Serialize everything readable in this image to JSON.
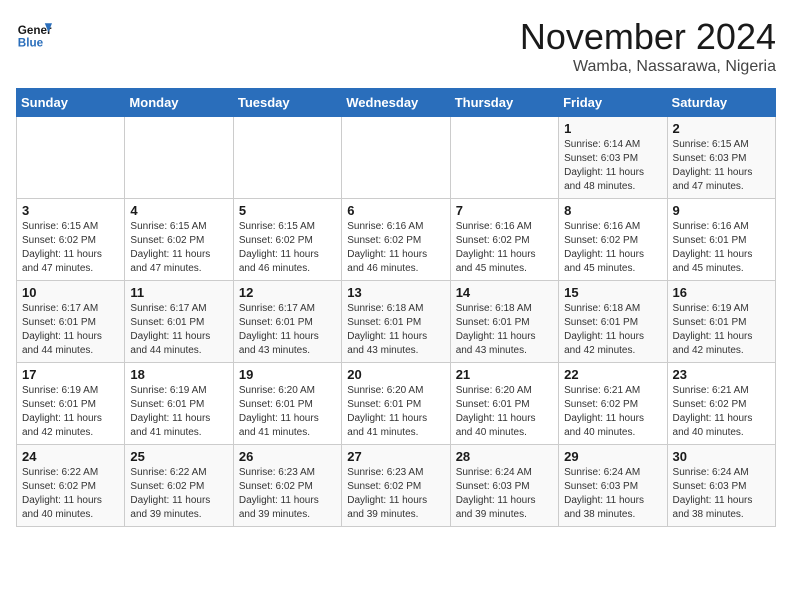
{
  "header": {
    "logo_line1": "General",
    "logo_line2": "Blue",
    "month": "November 2024",
    "location": "Wamba, Nassarawa, Nigeria"
  },
  "days_of_week": [
    "Sunday",
    "Monday",
    "Tuesday",
    "Wednesday",
    "Thursday",
    "Friday",
    "Saturday"
  ],
  "weeks": [
    [
      {
        "day": "",
        "info": ""
      },
      {
        "day": "",
        "info": ""
      },
      {
        "day": "",
        "info": ""
      },
      {
        "day": "",
        "info": ""
      },
      {
        "day": "",
        "info": ""
      },
      {
        "day": "1",
        "info": "Sunrise: 6:14 AM\nSunset: 6:03 PM\nDaylight: 11 hours and 48 minutes."
      },
      {
        "day": "2",
        "info": "Sunrise: 6:15 AM\nSunset: 6:03 PM\nDaylight: 11 hours and 47 minutes."
      }
    ],
    [
      {
        "day": "3",
        "info": "Sunrise: 6:15 AM\nSunset: 6:02 PM\nDaylight: 11 hours and 47 minutes."
      },
      {
        "day": "4",
        "info": "Sunrise: 6:15 AM\nSunset: 6:02 PM\nDaylight: 11 hours and 47 minutes."
      },
      {
        "day": "5",
        "info": "Sunrise: 6:15 AM\nSunset: 6:02 PM\nDaylight: 11 hours and 46 minutes."
      },
      {
        "day": "6",
        "info": "Sunrise: 6:16 AM\nSunset: 6:02 PM\nDaylight: 11 hours and 46 minutes."
      },
      {
        "day": "7",
        "info": "Sunrise: 6:16 AM\nSunset: 6:02 PM\nDaylight: 11 hours and 45 minutes."
      },
      {
        "day": "8",
        "info": "Sunrise: 6:16 AM\nSunset: 6:02 PM\nDaylight: 11 hours and 45 minutes."
      },
      {
        "day": "9",
        "info": "Sunrise: 6:16 AM\nSunset: 6:01 PM\nDaylight: 11 hours and 45 minutes."
      }
    ],
    [
      {
        "day": "10",
        "info": "Sunrise: 6:17 AM\nSunset: 6:01 PM\nDaylight: 11 hours and 44 minutes."
      },
      {
        "day": "11",
        "info": "Sunrise: 6:17 AM\nSunset: 6:01 PM\nDaylight: 11 hours and 44 minutes."
      },
      {
        "day": "12",
        "info": "Sunrise: 6:17 AM\nSunset: 6:01 PM\nDaylight: 11 hours and 43 minutes."
      },
      {
        "day": "13",
        "info": "Sunrise: 6:18 AM\nSunset: 6:01 PM\nDaylight: 11 hours and 43 minutes."
      },
      {
        "day": "14",
        "info": "Sunrise: 6:18 AM\nSunset: 6:01 PM\nDaylight: 11 hours and 43 minutes."
      },
      {
        "day": "15",
        "info": "Sunrise: 6:18 AM\nSunset: 6:01 PM\nDaylight: 11 hours and 42 minutes."
      },
      {
        "day": "16",
        "info": "Sunrise: 6:19 AM\nSunset: 6:01 PM\nDaylight: 11 hours and 42 minutes."
      }
    ],
    [
      {
        "day": "17",
        "info": "Sunrise: 6:19 AM\nSunset: 6:01 PM\nDaylight: 11 hours and 42 minutes."
      },
      {
        "day": "18",
        "info": "Sunrise: 6:19 AM\nSunset: 6:01 PM\nDaylight: 11 hours and 41 minutes."
      },
      {
        "day": "19",
        "info": "Sunrise: 6:20 AM\nSunset: 6:01 PM\nDaylight: 11 hours and 41 minutes."
      },
      {
        "day": "20",
        "info": "Sunrise: 6:20 AM\nSunset: 6:01 PM\nDaylight: 11 hours and 41 minutes."
      },
      {
        "day": "21",
        "info": "Sunrise: 6:20 AM\nSunset: 6:01 PM\nDaylight: 11 hours and 40 minutes."
      },
      {
        "day": "22",
        "info": "Sunrise: 6:21 AM\nSunset: 6:02 PM\nDaylight: 11 hours and 40 minutes."
      },
      {
        "day": "23",
        "info": "Sunrise: 6:21 AM\nSunset: 6:02 PM\nDaylight: 11 hours and 40 minutes."
      }
    ],
    [
      {
        "day": "24",
        "info": "Sunrise: 6:22 AM\nSunset: 6:02 PM\nDaylight: 11 hours and 40 minutes."
      },
      {
        "day": "25",
        "info": "Sunrise: 6:22 AM\nSunset: 6:02 PM\nDaylight: 11 hours and 39 minutes."
      },
      {
        "day": "26",
        "info": "Sunrise: 6:23 AM\nSunset: 6:02 PM\nDaylight: 11 hours and 39 minutes."
      },
      {
        "day": "27",
        "info": "Sunrise: 6:23 AM\nSunset: 6:02 PM\nDaylight: 11 hours and 39 minutes."
      },
      {
        "day": "28",
        "info": "Sunrise: 6:24 AM\nSunset: 6:03 PM\nDaylight: 11 hours and 39 minutes."
      },
      {
        "day": "29",
        "info": "Sunrise: 6:24 AM\nSunset: 6:03 PM\nDaylight: 11 hours and 38 minutes."
      },
      {
        "day": "30",
        "info": "Sunrise: 6:24 AM\nSunset: 6:03 PM\nDaylight: 11 hours and 38 minutes."
      }
    ]
  ]
}
